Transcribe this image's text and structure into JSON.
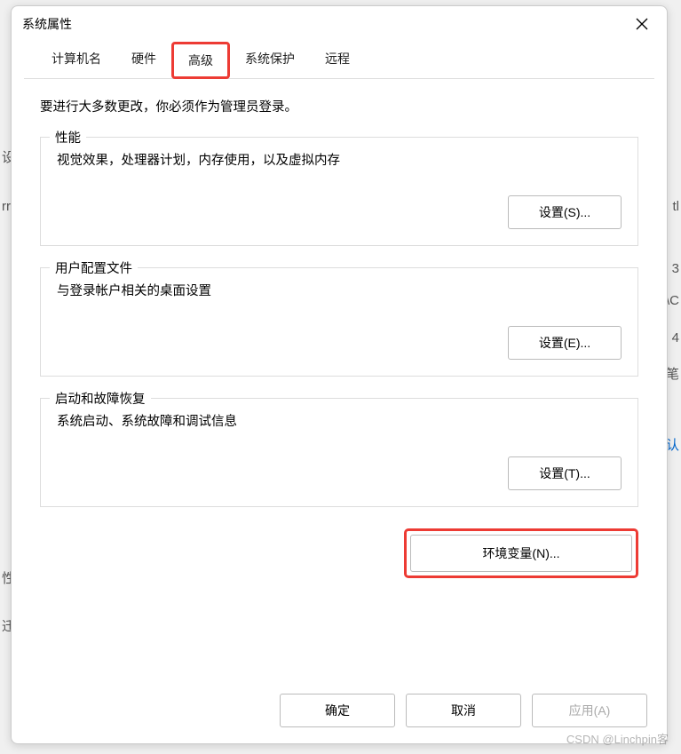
{
  "window": {
    "title": "系统属性"
  },
  "tabs": {
    "computer_name": "计算机名",
    "hardware": "硬件",
    "advanced": "高级",
    "system_protection": "系统保护",
    "remote": "远程"
  },
  "intro": "要进行大多数更改，你必须作为管理员登录。",
  "performance": {
    "title": "性能",
    "desc": "视觉效果，处理器计划，内存使用，以及虚拟内存",
    "button": "设置(S)..."
  },
  "user_profiles": {
    "title": "用户配置文件",
    "desc": "与登录帐户相关的桌面设置",
    "button": "设置(E)..."
  },
  "startup_recovery": {
    "title": "启动和故障恢复",
    "desc": "系统启动、系统故障和调试信息",
    "button": "设置(T)..."
  },
  "env_button": "环境变量(N)...",
  "footer": {
    "ok": "确定",
    "cancel": "取消",
    "apply": "应用(A)"
  },
  "watermark": "CSDN @Linchpin客",
  "bg": {
    "f1": "设",
    "f2": "rr",
    "f3": "tl",
    "f4": "3",
    "f5": "4",
    "f6": "笔",
    "f7": "认",
    "f8": "性",
    "f9": "迁",
    "f10": "\\C"
  }
}
